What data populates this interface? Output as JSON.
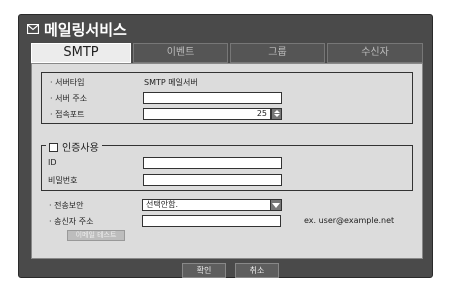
{
  "title": "메일링서비스",
  "tabs": [
    {
      "label": "SMTP",
      "active": true
    },
    {
      "label": "이벤트",
      "active": false
    },
    {
      "label": "그룹",
      "active": false
    },
    {
      "label": "수신자",
      "active": false
    }
  ],
  "server": {
    "type_label": "· 서버타입",
    "type_value": "SMTP 메일서버",
    "address_label": "· 서버 주소",
    "address_value": "",
    "port_label": "· 접속포트",
    "port_value": "25"
  },
  "auth": {
    "legend": "인증사용",
    "checked": false,
    "id_label": "ID",
    "id_value": "",
    "password_label": "비밀번호",
    "password_value": ""
  },
  "security": {
    "label": "· 전송보안",
    "selected": "선택안함."
  },
  "sender": {
    "label": "· 송신자 주소",
    "value": "",
    "example": "ex. user@example.net"
  },
  "buttons": {
    "test_mail": "이메일 테스트",
    "ok": "확인",
    "cancel": "취소"
  },
  "colors": {
    "panel": "#4a4a4a",
    "content": "#dcdcdc",
    "active_tab": "#ececec"
  }
}
